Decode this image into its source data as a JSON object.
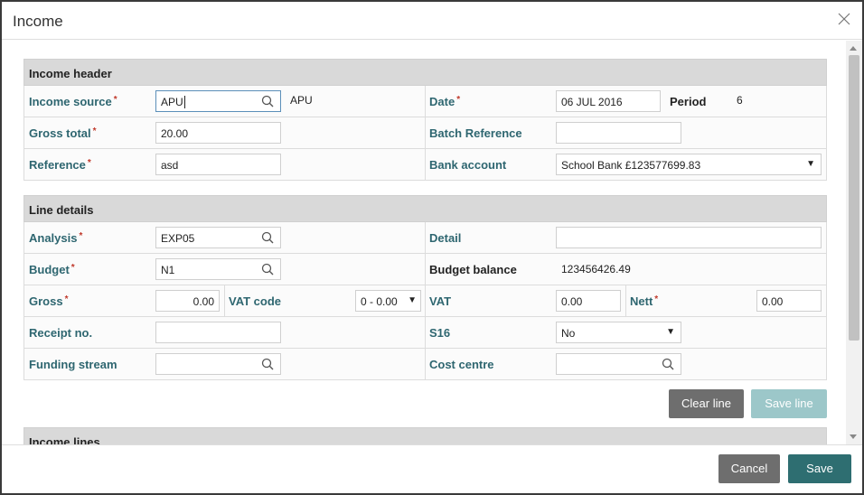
{
  "dialog": {
    "title": "Income"
  },
  "income_header": {
    "title": "Income header",
    "income_source": {
      "label": "Income source",
      "value": "APU",
      "display": "APU"
    },
    "date": {
      "label": "Date",
      "value": "06 JUL 2016"
    },
    "period": {
      "label": "Period",
      "value": "6"
    },
    "gross_total": {
      "label": "Gross total",
      "value": "20.00"
    },
    "batch_reference": {
      "label": "Batch Reference",
      "value": ""
    },
    "reference": {
      "label": "Reference",
      "value": "asd"
    },
    "bank_account": {
      "label": "Bank account",
      "value": "School Bank £123577699.83"
    }
  },
  "line_details": {
    "title": "Line details",
    "analysis": {
      "label": "Analysis",
      "value": "EXP05"
    },
    "detail": {
      "label": "Detail",
      "value": ""
    },
    "budget": {
      "label": "Budget",
      "value": "N1"
    },
    "budget_balance": {
      "label": "Budget balance",
      "value": "123456426.49"
    },
    "gross": {
      "label": "Gross",
      "value": "0.00"
    },
    "vat_code": {
      "label": "VAT code",
      "value": "0 - 0.00"
    },
    "vat": {
      "label": "VAT",
      "value": "0.00"
    },
    "nett": {
      "label": "Nett",
      "value": "0.00"
    },
    "receipt_no": {
      "label": "Receipt no.",
      "value": ""
    },
    "s16": {
      "label": "S16",
      "value": "No"
    },
    "funding_stream": {
      "label": "Funding stream",
      "value": ""
    },
    "cost_centre": {
      "label": "Cost centre",
      "value": ""
    },
    "clear_line_label": "Clear line",
    "save_line_label": "Save line"
  },
  "income_lines": {
    "title": "Income lines"
  },
  "footer": {
    "cancel_label": "Cancel",
    "save_label": "Save"
  },
  "required_marker": "*",
  "colors": {
    "label_teal": "#2e6670",
    "save_button": "#2e6e71",
    "save_line_disabled": "#9cc7c9",
    "clear_button": "#6e6e6e",
    "section_header_bg": "#d9d9d9",
    "required": "#c0392b"
  },
  "icons": {
    "close": "close-icon",
    "search": "search-icon",
    "dropdown": "chevron-down-icon"
  }
}
